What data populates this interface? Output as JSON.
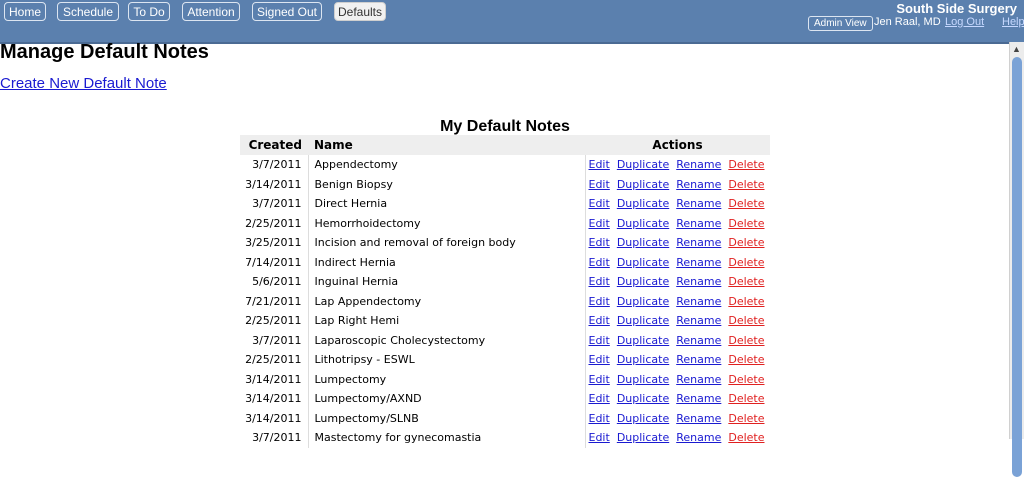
{
  "nav": {
    "tabs": [
      {
        "label": "Home",
        "active": false
      },
      {
        "label": "Schedule",
        "active": false
      },
      {
        "label": "To Do",
        "active": false
      },
      {
        "label": "Attention",
        "active": false
      },
      {
        "label": "Signed Out",
        "active": false
      },
      {
        "label": "Defaults",
        "active": true
      }
    ],
    "brand": "South Side Surgery",
    "admin_view": "Admin View",
    "user": "Jen Raal, MD",
    "logout": "Log Out",
    "help": "Help"
  },
  "page": {
    "title": "Manage Default Notes",
    "create_link": "Create New Default Note"
  },
  "notes": {
    "title": "My Default Notes",
    "columns": {
      "created": "Created",
      "name": "Name",
      "actions": "Actions"
    },
    "actions": {
      "edit": "Edit",
      "duplicate": "Duplicate",
      "rename": "Rename",
      "delete": "Delete"
    },
    "rows": [
      {
        "created": "3/7/2011",
        "name": "Appendectomy"
      },
      {
        "created": "3/14/2011",
        "name": "Benign Biopsy"
      },
      {
        "created": "3/7/2011",
        "name": "Direct Hernia"
      },
      {
        "created": "2/25/2011",
        "name": "Hemorrhoidectomy"
      },
      {
        "created": "3/25/2011",
        "name": "Incision and removal of foreign body"
      },
      {
        "created": "7/14/2011",
        "name": "Indirect Hernia"
      },
      {
        "created": "5/6/2011",
        "name": "Inguinal Hernia"
      },
      {
        "created": "7/21/2011",
        "name": "Lap Appendectomy"
      },
      {
        "created": "2/25/2011",
        "name": "Lap Right Hemi"
      },
      {
        "created": "3/7/2011",
        "name": "Laparoscopic Cholecystectomy"
      },
      {
        "created": "2/25/2011",
        "name": "Lithotripsy - ESWL"
      },
      {
        "created": "3/14/2011",
        "name": "Lumpectomy"
      },
      {
        "created": "3/14/2011",
        "name": "Lumpectomy/AXND"
      },
      {
        "created": "3/14/2011",
        "name": "Lumpectomy/SLNB"
      },
      {
        "created": "3/7/2011",
        "name": "Mastectomy for gynecomastia"
      }
    ]
  },
  "icons": {
    "scroll_up": "up-arrow-icon"
  },
  "colors": {
    "topbar": "#5b80ae",
    "link": "#1a1ad1",
    "delete": "#e02020",
    "header_bg": "#eeeeee"
  }
}
